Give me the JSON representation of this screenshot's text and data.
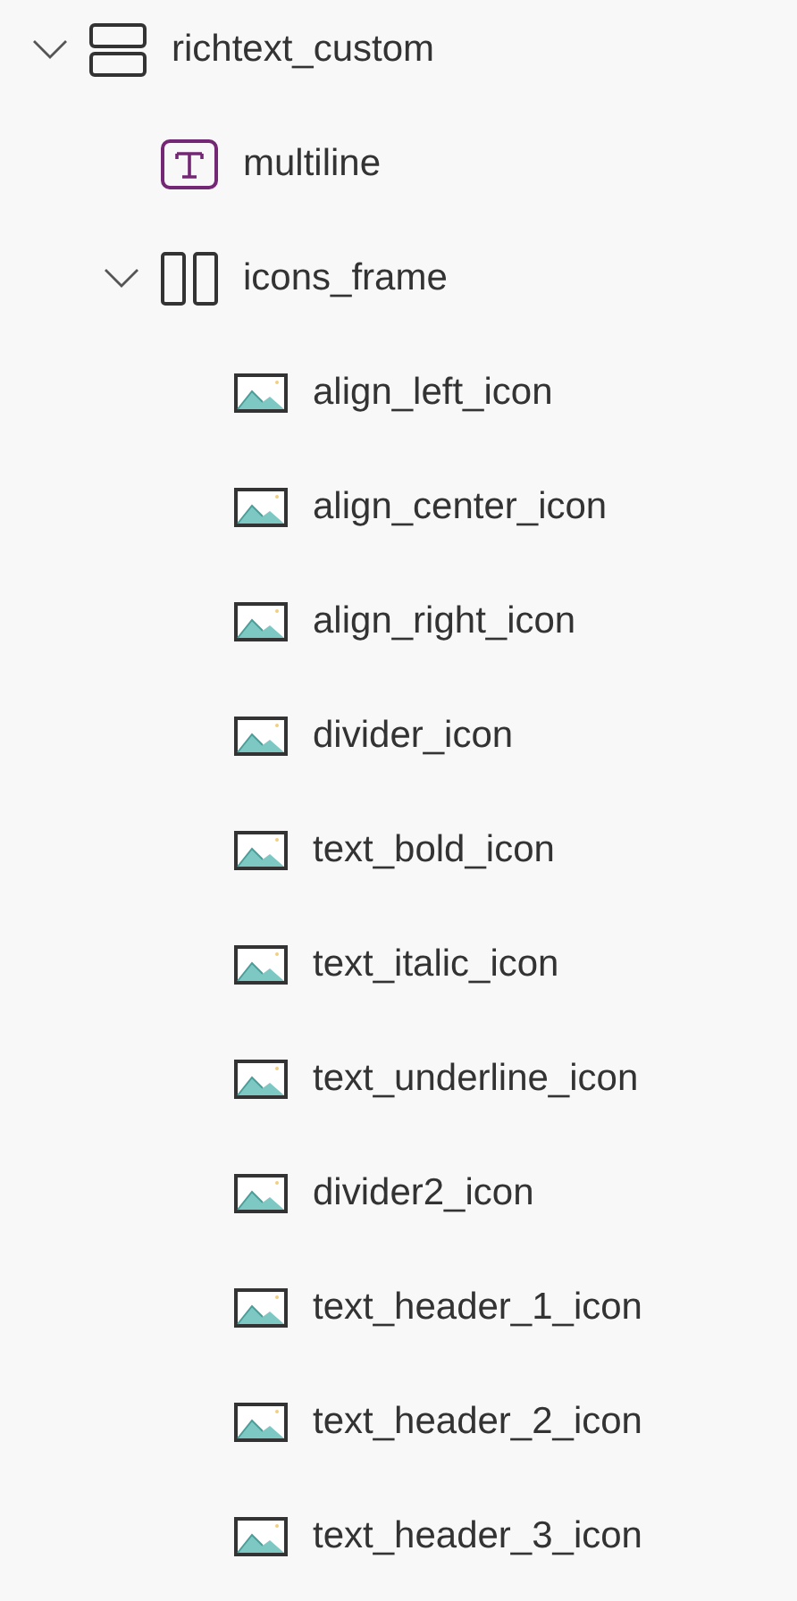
{
  "tree": [
    {
      "label": "richtext_custom",
      "kind": "vertical_container",
      "expanded": true,
      "children": [
        {
          "label": "multiline",
          "kind": "text"
        },
        {
          "label": "icons_frame",
          "kind": "horizontal_container",
          "expanded": true,
          "children": [
            {
              "label": "align_left_icon",
              "kind": "image"
            },
            {
              "label": "align_center_icon",
              "kind": "image"
            },
            {
              "label": "align_right_icon",
              "kind": "image"
            },
            {
              "label": "divider_icon",
              "kind": "image"
            },
            {
              "label": "text_bold_icon",
              "kind": "image"
            },
            {
              "label": "text_italic_icon",
              "kind": "image"
            },
            {
              "label": "text_underline_icon",
              "kind": "image"
            },
            {
              "label": "divider2_icon",
              "kind": "image"
            },
            {
              "label": "text_header_1_icon",
              "kind": "image"
            },
            {
              "label": "text_header_2_icon",
              "kind": "image"
            },
            {
              "label": "text_header_3_icon",
              "kind": "image"
            }
          ]
        }
      ]
    }
  ]
}
